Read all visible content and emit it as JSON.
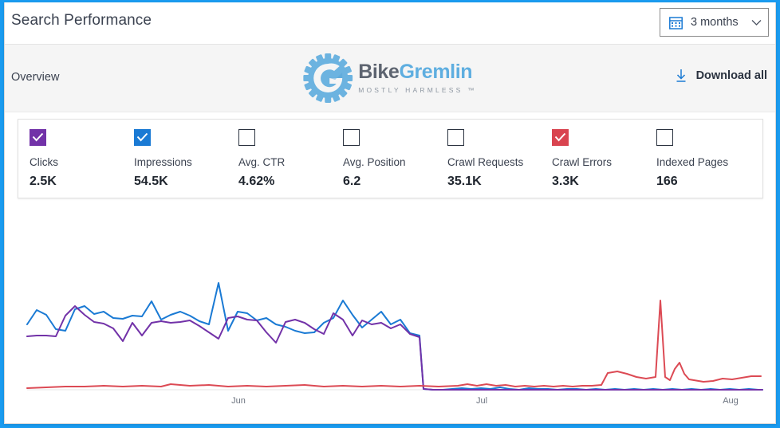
{
  "window": {
    "title": "Search Performance",
    "accent_blue": "#1a9bf0"
  },
  "range_select": {
    "icon": "calendar-icon",
    "value": "3 months",
    "chevron": "chevron-down-icon"
  },
  "band": {
    "overview_label": "Overview",
    "logo": {
      "mark": "gear-g-icon",
      "word_part1": "Bike",
      "word_part2": "Gremlin",
      "tagline": "MOSTLY HARMLESS ™",
      "color_part1": "#5d6470",
      "color_part2": "#5eaee0"
    },
    "download": {
      "icon": "download-arrow-icon",
      "label": "Download all"
    }
  },
  "metrics": [
    {
      "label": "Clicks",
      "value": "2.5K",
      "checked": true,
      "color": "#7232a8"
    },
    {
      "label": "Impressions",
      "value": "54.5K",
      "checked": true,
      "color": "#1a7ad4"
    },
    {
      "label": "Avg. CTR",
      "value": "4.62%",
      "checked": false,
      "color": "#2b3340"
    },
    {
      "label": "Avg. Position",
      "value": "6.2",
      "checked": false,
      "color": "#2b3340"
    },
    {
      "label": "Crawl Requests",
      "value": "35.1K",
      "checked": false,
      "color": "#2b3340"
    },
    {
      "label": "Crawl Errors",
      "value": "3.3K",
      "checked": true,
      "color": "#d9444f"
    },
    {
      "label": "Indexed Pages",
      "value": "166",
      "checked": false,
      "color": "#2b3340"
    }
  ],
  "chart_data": {
    "type": "line",
    "title": "",
    "xlabel": "",
    "ylabel": "",
    "grid": false,
    "legend": "none",
    "x_tick_labels": [
      "Jun",
      "Jul",
      "Aug"
    ],
    "x_tick_positions": [
      293,
      598,
      910
    ],
    "x_range": [
      28,
      950
    ],
    "baseline_y": 485,
    "series": [
      {
        "name": "Impressions",
        "color": "#1a7ad4",
        "points": [
          [
            28,
            404
          ],
          [
            40,
            386
          ],
          [
            52,
            392
          ],
          [
            64,
            410
          ],
          [
            76,
            412
          ],
          [
            88,
            385
          ],
          [
            100,
            381
          ],
          [
            112,
            391
          ],
          [
            124,
            388
          ],
          [
            136,
            396
          ],
          [
            148,
            397
          ],
          [
            160,
            393
          ],
          [
            172,
            394
          ],
          [
            184,
            375
          ],
          [
            196,
            398
          ],
          [
            208,
            392
          ],
          [
            220,
            388
          ],
          [
            232,
            393
          ],
          [
            244,
            400
          ],
          [
            256,
            404
          ],
          [
            268,
            352
          ],
          [
            280,
            412
          ],
          [
            292,
            388
          ],
          [
            304,
            390
          ],
          [
            316,
            399
          ],
          [
            328,
            396
          ],
          [
            340,
            404
          ],
          [
            352,
            407
          ],
          [
            364,
            412
          ],
          [
            376,
            415
          ],
          [
            388,
            414
          ],
          [
            400,
            402
          ],
          [
            412,
            396
          ],
          [
            424,
            374
          ],
          [
            436,
            392
          ],
          [
            448,
            408
          ],
          [
            460,
            398
          ],
          [
            472,
            388
          ],
          [
            484,
            404
          ],
          [
            496,
            398
          ],
          [
            508,
            415
          ],
          [
            520,
            418
          ],
          [
            525,
            485
          ],
          [
            537,
            486
          ],
          [
            549,
            486
          ],
          [
            561,
            485
          ],
          [
            573,
            484
          ],
          [
            585,
            485
          ],
          [
            597,
            484
          ],
          [
            609,
            485
          ],
          [
            621,
            483
          ],
          [
            633,
            485
          ],
          [
            645,
            486
          ],
          [
            657,
            484
          ],
          [
            669,
            485
          ],
          [
            681,
            485
          ],
          [
            693,
            486
          ],
          [
            705,
            485
          ],
          [
            717,
            485
          ],
          [
            729,
            486
          ],
          [
            741,
            485
          ],
          [
            753,
            486
          ],
          [
            765,
            485
          ],
          [
            777,
            486
          ],
          [
            789,
            485
          ],
          [
            801,
            486
          ],
          [
            813,
            485
          ],
          [
            825,
            486
          ],
          [
            837,
            485
          ],
          [
            849,
            486
          ],
          [
            861,
            485
          ],
          [
            873,
            486
          ],
          [
            885,
            485
          ],
          [
            897,
            486
          ],
          [
            909,
            485
          ],
          [
            921,
            486
          ],
          [
            933,
            485
          ],
          [
            945,
            486
          ],
          [
            950,
            486
          ]
        ]
      },
      {
        "name": "Clicks",
        "color": "#7232a8",
        "points": [
          [
            28,
            419
          ],
          [
            40,
            418
          ],
          [
            52,
            418
          ],
          [
            64,
            419
          ],
          [
            76,
            393
          ],
          [
            88,
            381
          ],
          [
            100,
            392
          ],
          [
            112,
            401
          ],
          [
            124,
            403
          ],
          [
            136,
            409
          ],
          [
            148,
            425
          ],
          [
            160,
            402
          ],
          [
            172,
            418
          ],
          [
            184,
            402
          ],
          [
            196,
            400
          ],
          [
            208,
            402
          ],
          [
            220,
            401
          ],
          [
            232,
            399
          ],
          [
            244,
            406
          ],
          [
            256,
            414
          ],
          [
            268,
            422
          ],
          [
            280,
            396
          ],
          [
            292,
            394
          ],
          [
            304,
            398
          ],
          [
            316,
            399
          ],
          [
            328,
            414
          ],
          [
            340,
            427
          ],
          [
            352,
            401
          ],
          [
            364,
            398
          ],
          [
            376,
            402
          ],
          [
            388,
            410
          ],
          [
            400,
            416
          ],
          [
            412,
            390
          ],
          [
            424,
            398
          ],
          [
            436,
            418
          ],
          [
            448,
            399
          ],
          [
            460,
            404
          ],
          [
            472,
            402
          ],
          [
            484,
            409
          ],
          [
            496,
            404
          ],
          [
            508,
            416
          ],
          [
            520,
            420
          ],
          [
            525,
            485
          ],
          [
            537,
            486
          ],
          [
            549,
            486
          ],
          [
            561,
            486
          ],
          [
            573,
            486
          ],
          [
            585,
            486
          ],
          [
            597,
            486
          ],
          [
            609,
            486
          ],
          [
            621,
            486
          ],
          [
            633,
            486
          ],
          [
            645,
            486
          ],
          [
            657,
            486
          ],
          [
            669,
            486
          ],
          [
            681,
            486
          ],
          [
            693,
            486
          ],
          [
            705,
            486
          ],
          [
            717,
            486
          ],
          [
            729,
            486
          ],
          [
            741,
            486
          ],
          [
            753,
            486
          ],
          [
            765,
            486
          ],
          [
            777,
            486
          ],
          [
            789,
            486
          ],
          [
            801,
            486
          ],
          [
            813,
            486
          ],
          [
            825,
            486
          ],
          [
            837,
            486
          ],
          [
            849,
            486
          ],
          [
            861,
            486
          ],
          [
            873,
            486
          ],
          [
            885,
            486
          ],
          [
            897,
            486
          ],
          [
            909,
            486
          ],
          [
            921,
            486
          ],
          [
            933,
            486
          ],
          [
            945,
            486
          ],
          [
            950,
            486
          ]
        ]
      },
      {
        "name": "Crawl Errors",
        "color": "#dc4a54",
        "points": [
          [
            28,
            484
          ],
          [
            52,
            483
          ],
          [
            76,
            482
          ],
          [
            100,
            482
          ],
          [
            124,
            481
          ],
          [
            148,
            482
          ],
          [
            172,
            481
          ],
          [
            196,
            482
          ],
          [
            208,
            479
          ],
          [
            232,
            481
          ],
          [
            256,
            480
          ],
          [
            280,
            482
          ],
          [
            304,
            481
          ],
          [
            328,
            482
          ],
          [
            352,
            481
          ],
          [
            376,
            480
          ],
          [
            400,
            482
          ],
          [
            424,
            481
          ],
          [
            448,
            482
          ],
          [
            472,
            481
          ],
          [
            496,
            482
          ],
          [
            520,
            481
          ],
          [
            544,
            482
          ],
          [
            568,
            481
          ],
          [
            580,
            479
          ],
          [
            592,
            481
          ],
          [
            604,
            479
          ],
          [
            616,
            481
          ],
          [
            628,
            480
          ],
          [
            640,
            482
          ],
          [
            652,
            481
          ],
          [
            664,
            482
          ],
          [
            676,
            481
          ],
          [
            688,
            482
          ],
          [
            700,
            481
          ],
          [
            712,
            482
          ],
          [
            724,
            481
          ],
          [
            736,
            481
          ],
          [
            748,
            480
          ],
          [
            756,
            465
          ],
          [
            768,
            463
          ],
          [
            780,
            466
          ],
          [
            792,
            470
          ],
          [
            804,
            472
          ],
          [
            810,
            471
          ],
          [
            816,
            470
          ],
          [
            822,
            374
          ],
          [
            828,
            470
          ],
          [
            834,
            474
          ],
          [
            840,
            460
          ],
          [
            846,
            452
          ],
          [
            852,
            466
          ],
          [
            858,
            473
          ],
          [
            864,
            474
          ],
          [
            876,
            476
          ],
          [
            888,
            475
          ],
          [
            900,
            472
          ],
          [
            912,
            473
          ],
          [
            924,
            471
          ],
          [
            936,
            469
          ],
          [
            948,
            469
          ]
        ]
      }
    ]
  }
}
